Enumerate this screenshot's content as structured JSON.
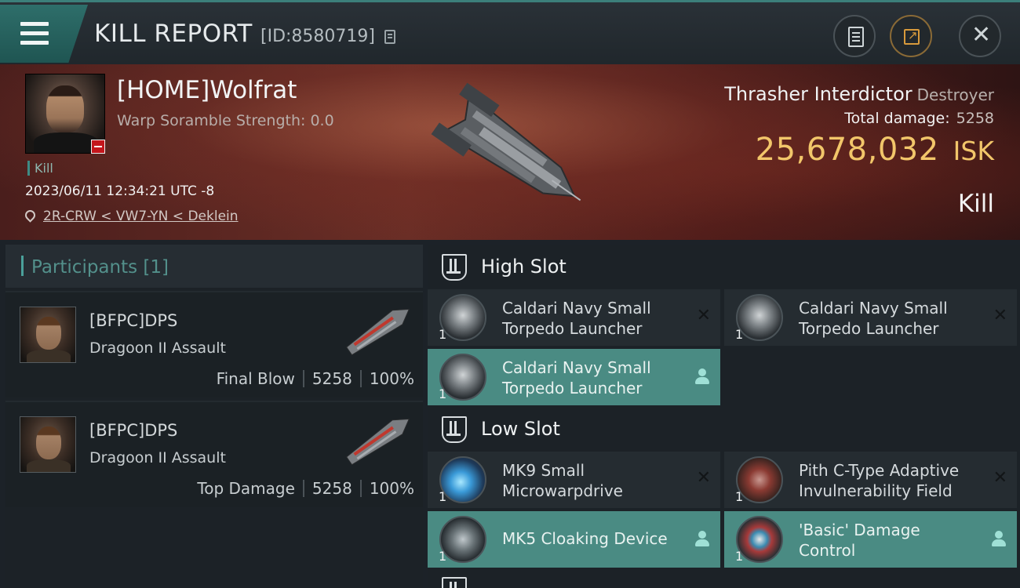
{
  "header": {
    "title": "KILL REPORT",
    "report_id": "[ID:8580719]",
    "icons": [
      "menu-icon",
      "copy-icon",
      "notes-icon",
      "share-icon",
      "close-icon"
    ]
  },
  "victim": {
    "name": "[HOME]Wolfrat",
    "warp_scramble": "Warp Soramble Strength: 0.0",
    "tag": "Kill",
    "datetime": "2023/06/11 12:34:21 UTC -8",
    "location": "2R-CRW < VW7-YN < Deklein"
  },
  "summary": {
    "ship_name": "Thrasher Interdictor",
    "ship_class": "Destroyer",
    "total_damage_label": "Total damage:",
    "total_damage_value": "5258",
    "isk_value": "25,678,032",
    "isk_unit": "ISK",
    "result": "Kill",
    "isk_color": "#f2c66a"
  },
  "participants": {
    "title": "Participants",
    "count": "[1]",
    "rows": [
      {
        "name": "[BFPC]DPS",
        "ship": "Dragoon II Assault",
        "label": "Final Blow",
        "damage": "5258",
        "percent": "100%"
      },
      {
        "name": "[BFPC]DPS",
        "ship": "Dragoon II Assault",
        "label": "Top Damage",
        "damage": "5258",
        "percent": "100%"
      }
    ]
  },
  "fitting": {
    "high_slot": {
      "title": "High Slot",
      "modules": [
        {
          "name": "Caldari Navy Small Torpedo Launcher",
          "qty": "1",
          "status": "destroyed"
        },
        {
          "name": "Caldari Navy Small Torpedo Launcher",
          "qty": "1",
          "status": "destroyed"
        },
        {
          "name": "Caldari Navy Small Torpedo Launcher",
          "qty": "1",
          "status": "dropped"
        }
      ]
    },
    "low_slot": {
      "title": "Low Slot",
      "modules": [
        {
          "name": "MK9 Small Microwarpdrive",
          "qty": "1",
          "status": "destroyed"
        },
        {
          "name": "Pith C-Type Adaptive Invulnerability Field",
          "qty": "1",
          "status": "destroyed"
        },
        {
          "name": "MK5 Cloaking Device",
          "qty": "1",
          "status": "dropped"
        },
        {
          "name": "'Basic' Damage Control",
          "qty": "1",
          "status": "dropped"
        }
      ]
    },
    "dropped_color": "#4a8b83"
  }
}
